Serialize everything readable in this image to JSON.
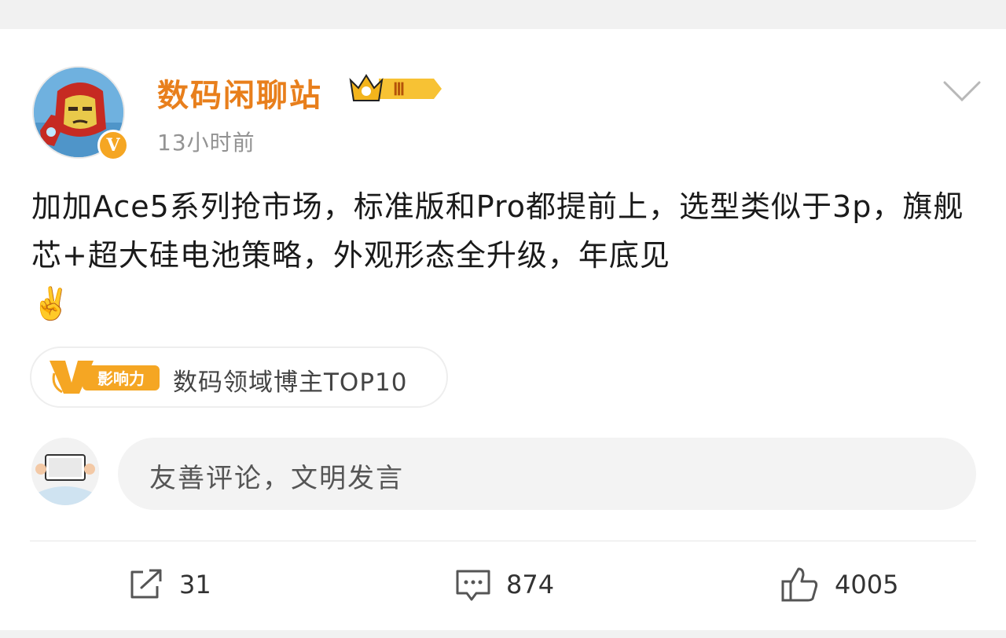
{
  "post": {
    "author": {
      "name": "数码闲聊站",
      "level_badge": "Ⅲ",
      "verified_mark": "V"
    },
    "time": "13小时前",
    "text": "加加Ace5系列抢市场，标准版和Pro都提前上，选型类似于3p，旗舰芯+超大硅电池策略，外观形态全升级，年底见",
    "emoji": "✌️",
    "influence": {
      "badge_label": "影响力",
      "text": "数码领域博主TOP10"
    }
  },
  "comment_box": {
    "placeholder": "友善评论，文明发言"
  },
  "actions": {
    "share_count": "31",
    "comment_count": "874",
    "like_count": "4005"
  },
  "colors": {
    "username": "#e87f1c",
    "verified": "#f5a623",
    "influence_badge": "#f5a623"
  }
}
